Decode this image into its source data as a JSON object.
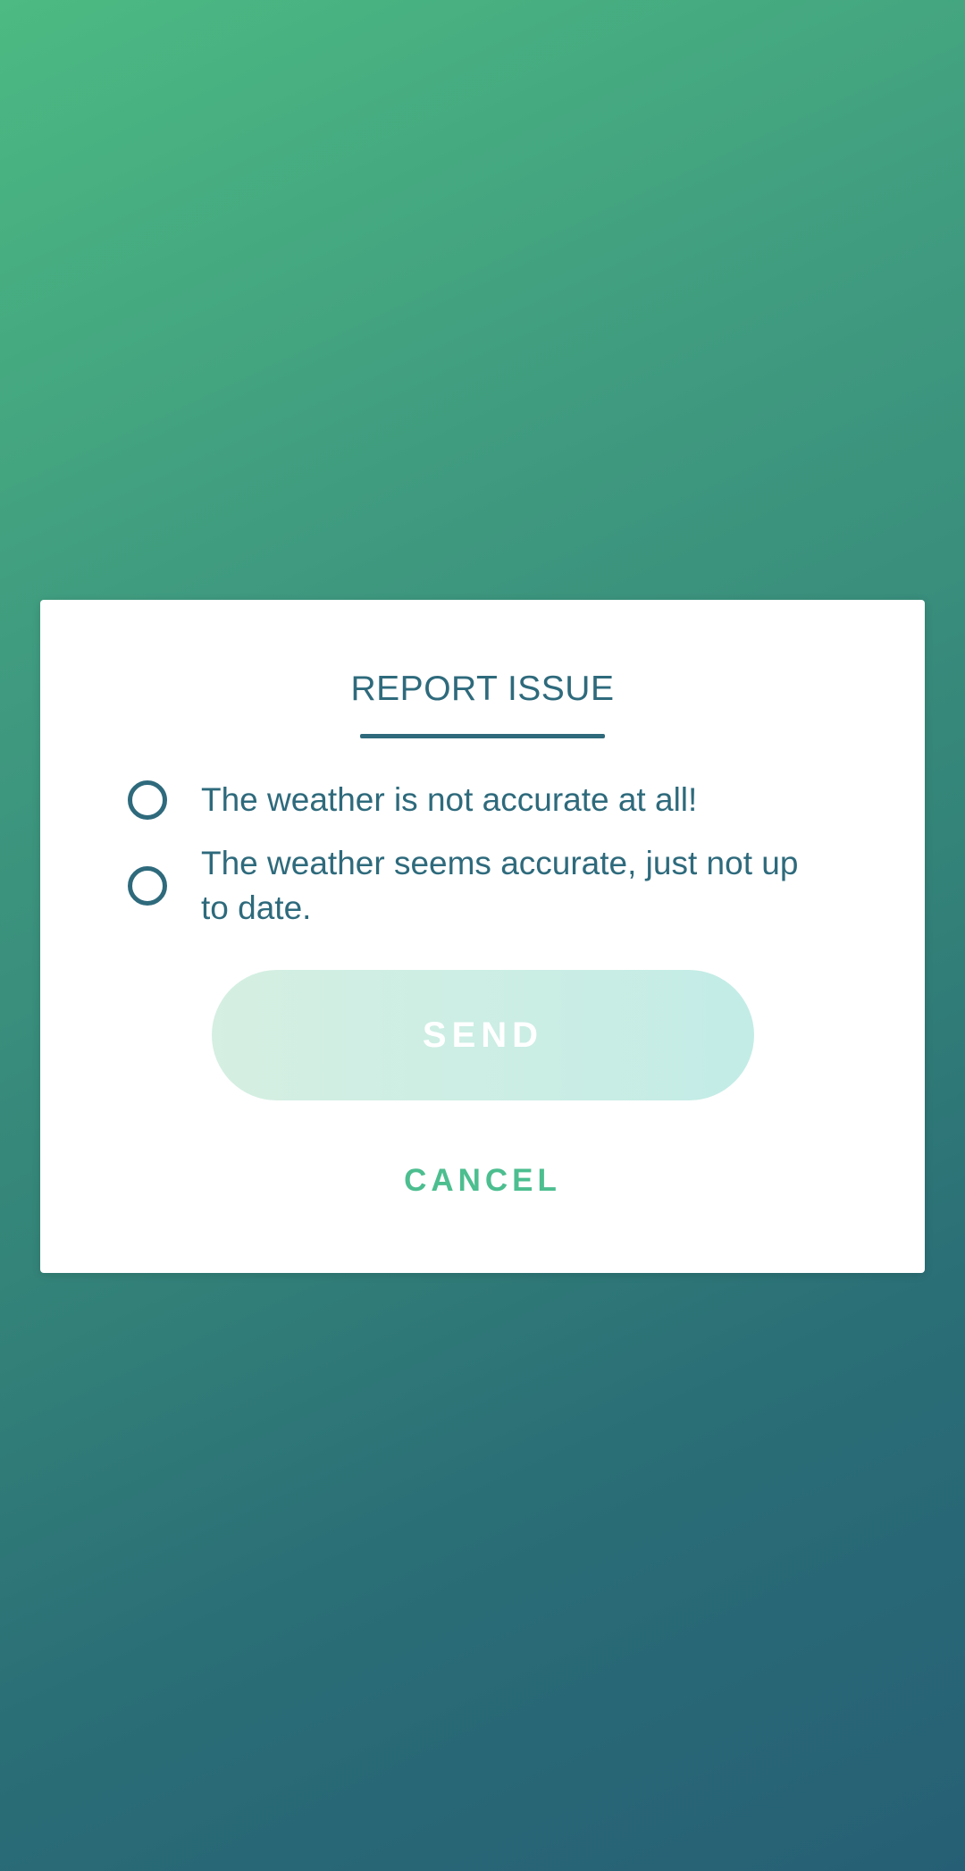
{
  "dialog": {
    "title": "REPORT ISSUE",
    "options": [
      {
        "label": "The weather is not accurate at all!",
        "selected": false
      },
      {
        "label": "The weather seems accurate, just not up to date.",
        "selected": false
      }
    ],
    "send_label": "SEND",
    "cancel_label": "CANCEL"
  },
  "colors": {
    "background_top": "#4cba82",
    "background_bottom": "#265f75",
    "text_primary": "#2e6a7c",
    "send_button_start": "#d5efe2",
    "send_button_end": "#c3ece6",
    "cancel_text": "#4cbe8f"
  }
}
